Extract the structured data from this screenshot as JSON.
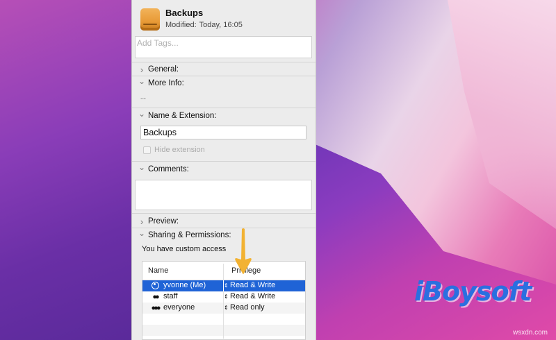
{
  "file": {
    "name": "Backups",
    "modified_label": "Modified:",
    "modified_value": "Today, 16:05"
  },
  "tags": {
    "placeholder": "Add Tags..."
  },
  "sections": {
    "general": "General:",
    "more_info": "More Info:",
    "more_info_value": "--",
    "name_extension": "Name & Extension:",
    "name_value": "Backups",
    "hide_extension": "Hide extension",
    "comments": "Comments:",
    "preview": "Preview:",
    "sharing": "Sharing & Permissions:"
  },
  "sharing": {
    "custom_access": "You have custom access",
    "columns": {
      "name": "Name",
      "privilege": "Privilege"
    },
    "rows": [
      {
        "name": "yvonne (Me)",
        "privilege": "Read & Write",
        "selected": true,
        "icon": "user-circle-icon"
      },
      {
        "name": "staff",
        "privilege": "Read & Write",
        "selected": false,
        "icon": "group-icon"
      },
      {
        "name": "everyone",
        "privilege": "Read only",
        "selected": false,
        "icon": "everyone-icon"
      }
    ]
  },
  "watermark": {
    "brand": "iBoysoft",
    "url": "wsxdn.com"
  },
  "colors": {
    "selection": "#1f63d6",
    "arrow": "#f2b233",
    "brand": "#2a6fe0"
  }
}
